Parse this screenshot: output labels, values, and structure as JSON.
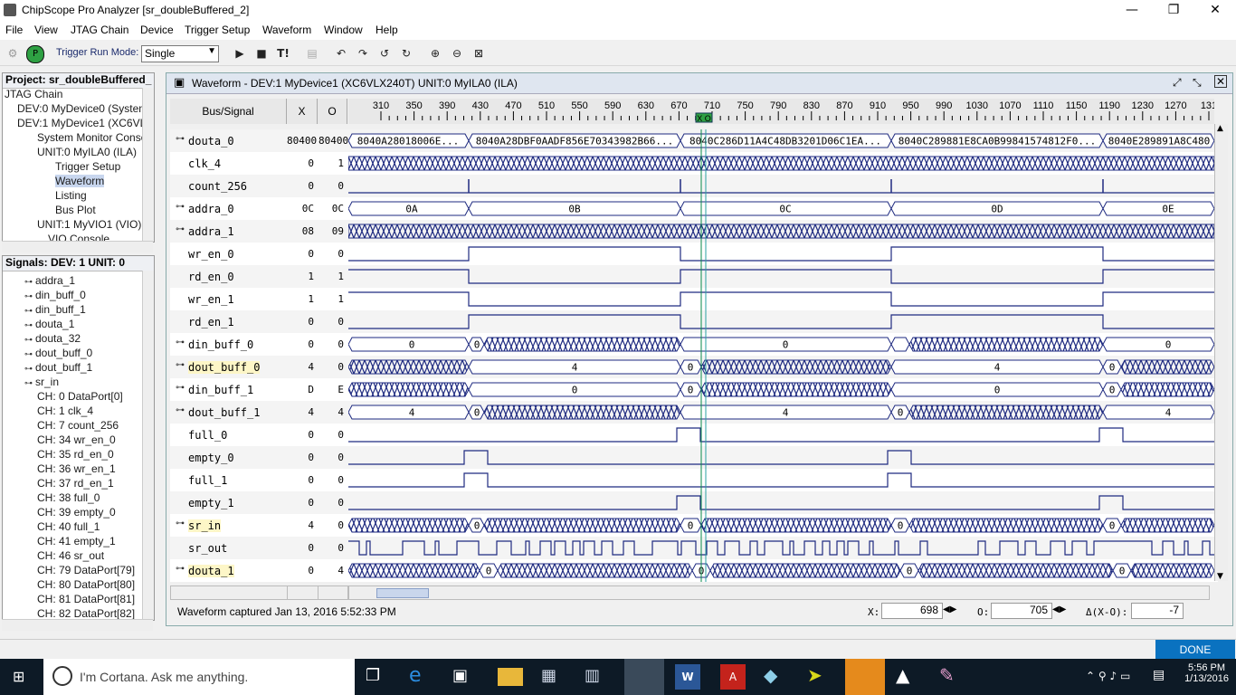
{
  "window": {
    "title": "ChipScope Pro Analyzer [sr_doubleBuffered_2]",
    "min": "—",
    "max": "❐",
    "close": "✕"
  },
  "menu": [
    "File",
    "View",
    "JTAG Chain",
    "Device",
    "Trigger Setup",
    "Waveform",
    "Window",
    "Help"
  ],
  "toolbar": {
    "trigger_run_mode_label": "Trigger Run Mode:",
    "trigger_run_mode_value": "Single",
    "run_glyph": "▶",
    "stop_glyph": "■",
    "trigger_now_glyph": "T!"
  },
  "project_panel": {
    "title": "Project: sr_doubleBuffered_",
    "items": [
      "JTAG Chain",
      "DEV:0 MyDevice0 (System",
      "DEV:1 MyDevice1 (XC6VL",
      "System Monitor Conso",
      "UNIT:0 MyILA0 (ILA)",
      "Trigger Setup",
      "Waveform",
      "Listing",
      "Bus Plot",
      "UNIT:1 MyVIO1 (VIO)",
      "VIO Console"
    ]
  },
  "signals_panel": {
    "title": "Signals: DEV: 1 UNIT: 0",
    "items": [
      "addra_1",
      "din_buff_0",
      "din_buff_1",
      "douta_1",
      "douta_32",
      "dout_buff_0",
      "dout_buff_1",
      "sr_in",
      "CH: 0 DataPort[0]",
      "CH: 1 clk_4",
      "CH: 7 count_256",
      "CH: 34 wr_en_0",
      "CH: 35 rd_en_0",
      "CH: 36 wr_en_1",
      "CH: 37 rd_en_1",
      "CH: 38 full_0",
      "CH: 39 empty_0",
      "CH: 40 full_1",
      "CH: 41 empty_1",
      "CH: 46 sr_out",
      "CH: 79 DataPort[79]",
      "CH: 80 DataPort[80]",
      "CH: 81 DataPort[81]",
      "CH: 82 DataPort[82]"
    ]
  },
  "waveform": {
    "title": "Waveform - DEV:1 MyDevice1 (XC6VLX240T) UNIT:0 MyILA0 (ILA)",
    "col_bus_signal": "Bus/Signal",
    "col_x": "X",
    "col_o": "O",
    "ticks": [
      "310",
      "350",
      "390",
      "430",
      "470",
      "510",
      "550",
      "590",
      "630",
      "670",
      "710",
      "750",
      "790",
      "830",
      "870",
      "910",
      "950",
      "990",
      "1030",
      "1070",
      "1110",
      "1150",
      "1190",
      "1230",
      "1270",
      "131"
    ],
    "cursor_label": "X O",
    "signals": [
      {
        "name": "douta_0",
        "x": "80400",
        "o": "80400",
        "bus": true
      },
      {
        "name": "clk_4",
        "x": "0",
        "o": "1",
        "bus": false
      },
      {
        "name": "count_256",
        "x": "0",
        "o": "0",
        "bus": false
      },
      {
        "name": "addra_0",
        "x": "0C",
        "o": "0C",
        "bus": true
      },
      {
        "name": "addra_1",
        "x": "08",
        "o": "09",
        "bus": true
      },
      {
        "name": "wr_en_0",
        "x": "0",
        "o": "0",
        "bus": false
      },
      {
        "name": "rd_en_0",
        "x": "1",
        "o": "1",
        "bus": false
      },
      {
        "name": "wr_en_1",
        "x": "1",
        "o": "1",
        "bus": false
      },
      {
        "name": "rd_en_1",
        "x": "0",
        "o": "0",
        "bus": false
      },
      {
        "name": "din_buff_0",
        "x": "0",
        "o": "0",
        "bus": true
      },
      {
        "name": "dout_buff_0",
        "x": "4",
        "o": "0",
        "bus": true,
        "hl": true
      },
      {
        "name": "din_buff_1",
        "x": "D",
        "o": "E",
        "bus": true
      },
      {
        "name": "dout_buff_1",
        "x": "4",
        "o": "4",
        "bus": true
      },
      {
        "name": "full_0",
        "x": "0",
        "o": "0",
        "bus": false
      },
      {
        "name": "empty_0",
        "x": "0",
        "o": "0",
        "bus": false
      },
      {
        "name": "full_1",
        "x": "0",
        "o": "0",
        "bus": false
      },
      {
        "name": "empty_1",
        "x": "0",
        "o": "0",
        "bus": false
      },
      {
        "name": "sr_in",
        "x": "4",
        "o": "0",
        "bus": true,
        "hl": true
      },
      {
        "name": "sr_out",
        "x": "0",
        "o": "0",
        "bus": false
      },
      {
        "name": "douta_1",
        "x": "0",
        "o": "4",
        "bus": true,
        "hl": true
      }
    ],
    "douta_0_labels": [
      "8040A28018006E...",
      "8040A28DBF0AADF856E70343982B66...",
      "8040C286D11A4C48DB3201D06C1EA...",
      "8040C289881E8CA0B99841574812F0...",
      "8040E289891A8C480"
    ],
    "addra_0_labels": [
      "0A",
      "0B",
      "0C",
      "0D",
      "0E"
    ],
    "din_buff_0_labels": [
      "0",
      "0",
      "0",
      "0"
    ],
    "dout_buff_0_labels": [
      "4",
      "0",
      "4",
      "0"
    ],
    "din_buff_1_labels": [
      "0",
      "0",
      "0",
      "0"
    ],
    "dout_buff_1_labels": [
      "4",
      "0",
      "4",
      "0",
      "4"
    ],
    "sr_in_labels": [
      "0",
      "0",
      "0",
      "0"
    ],
    "douta_1_labels": [
      "0",
      "0",
      "0",
      "0"
    ],
    "status_text": "Waveform captured Jan 13, 2016 5:52:33 PM",
    "x_label": "X:",
    "x_value": "698",
    "o_label": "O:",
    "o_value": "705",
    "delta_label": "Δ(X-O):",
    "delta_value": "-7"
  },
  "done_label": "DONE",
  "taskbar": {
    "cortana_placeholder": "I'm Cortana. Ask me anything.",
    "time": "5:56 PM",
    "date": "1/13/2016"
  }
}
